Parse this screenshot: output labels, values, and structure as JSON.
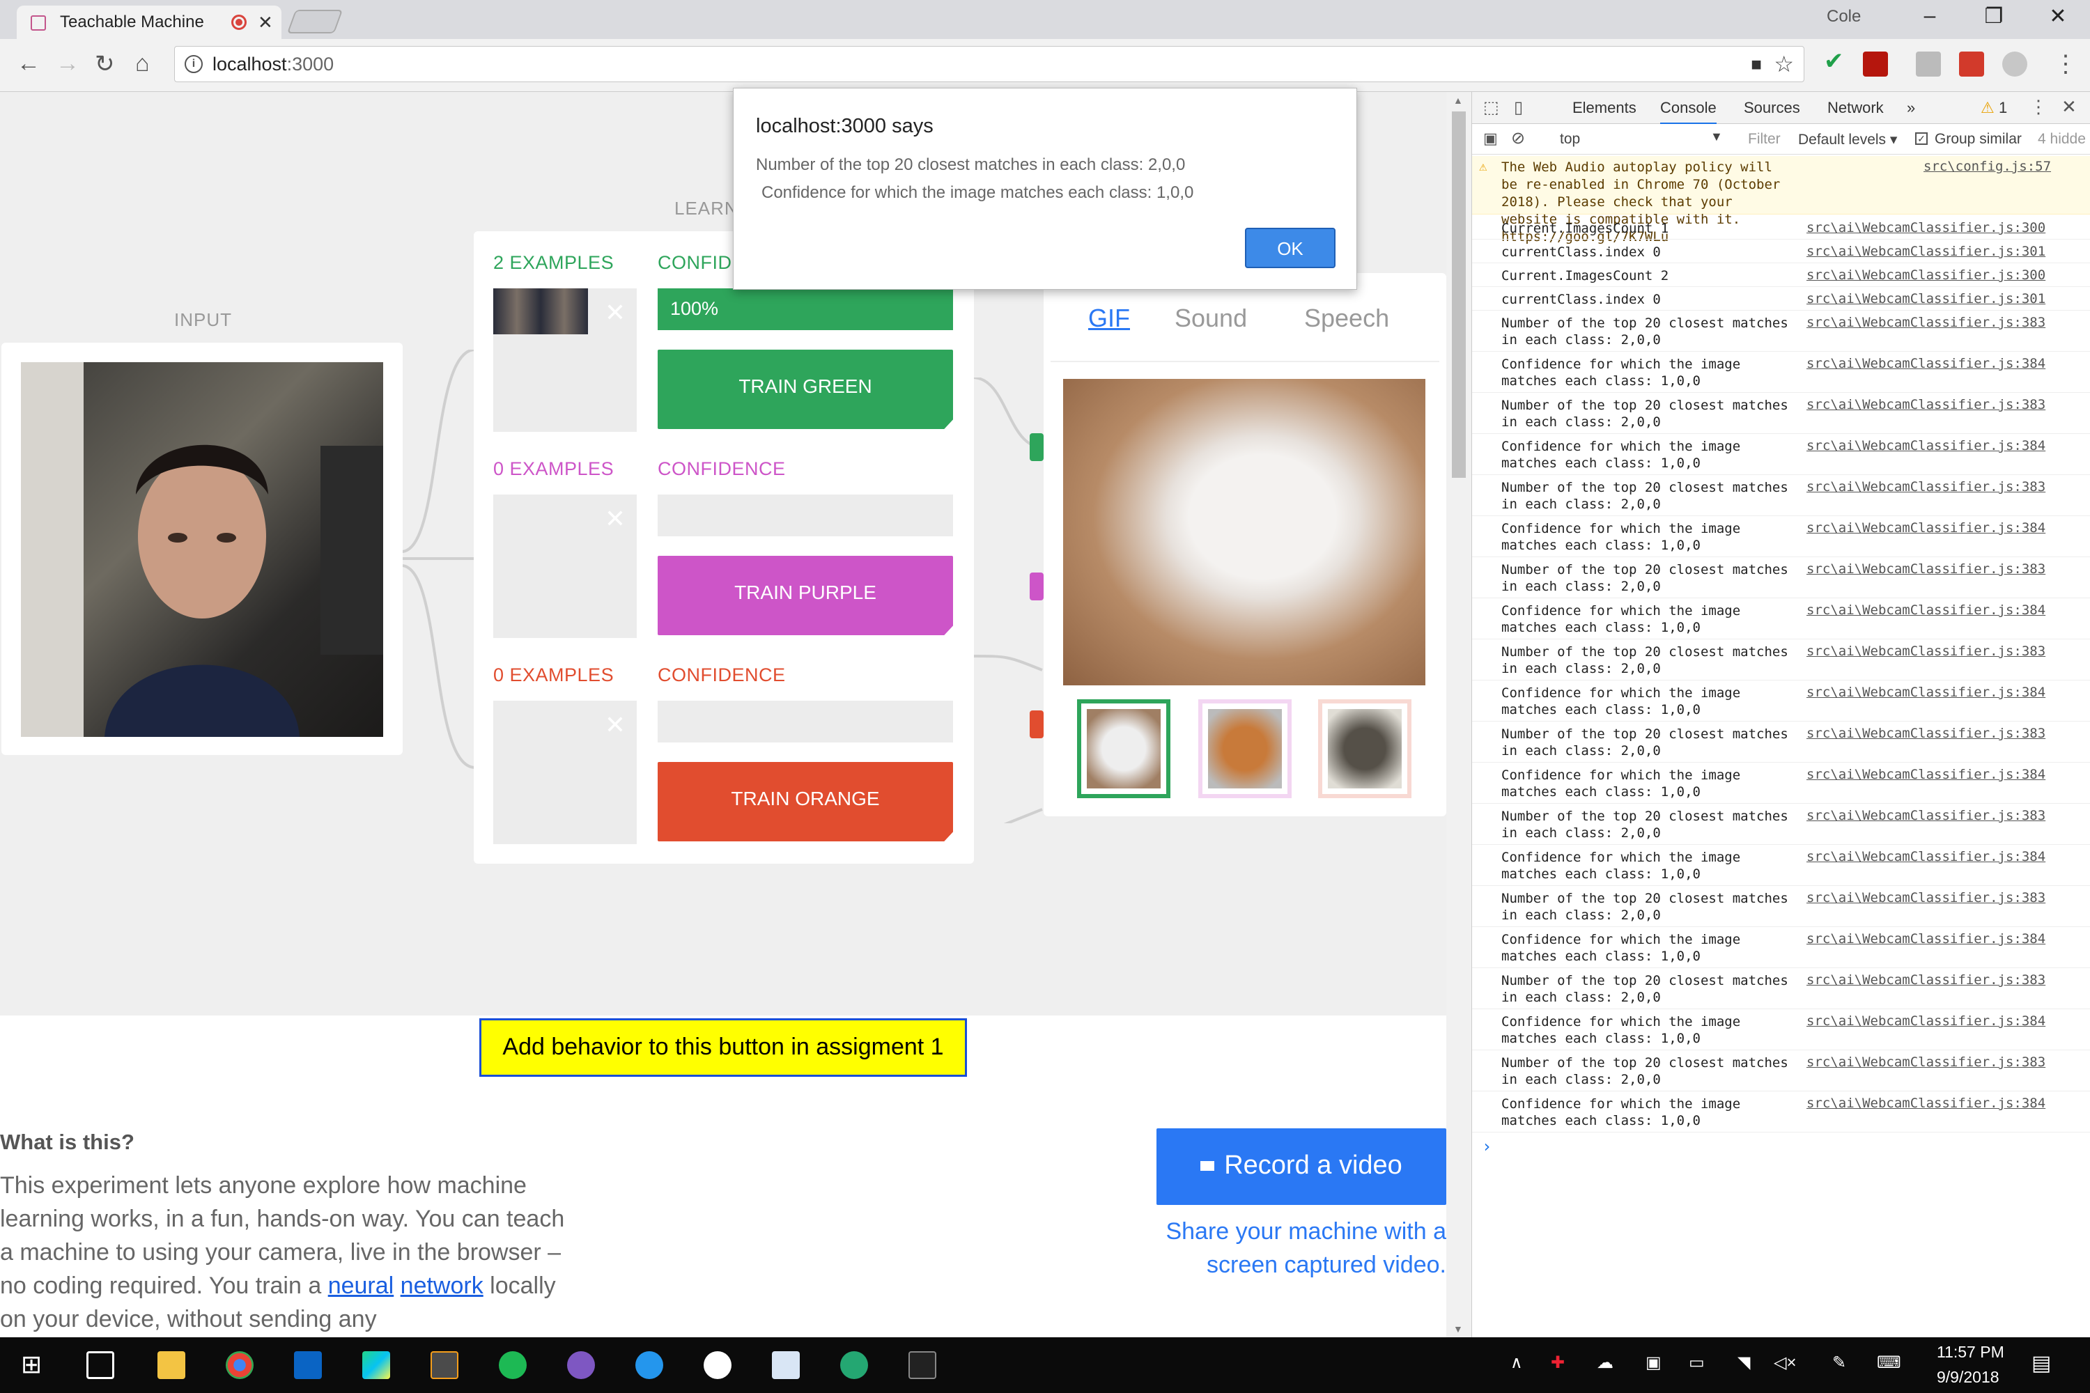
{
  "browser": {
    "tab_title": "Teachable Machine",
    "tab_close": "✕",
    "user": "Cole",
    "url_host": "localhost",
    "url_port": ":3000"
  },
  "page": {
    "input_label": "INPUT",
    "learning_label": "LEARNING",
    "classes": [
      {
        "examples": "2 EXAMPLES",
        "confidence_label": "CONFIDENCE",
        "confidence_value": "100%",
        "confidence": 1.0,
        "button": "TRAIN GREEN",
        "color": "#2ea55b"
      },
      {
        "examples": "0 EXAMPLES",
        "confidence_label": "CONFIDENCE",
        "confidence_value": "",
        "confidence": 0.0,
        "button": "TRAIN PURPLE",
        "color": "#cd55c8"
      },
      {
        "examples": "0 EXAMPLES",
        "confidence_label": "CONFIDENCE",
        "confidence_value": "",
        "confidence": 0.0,
        "button": "TRAIN ORANGE",
        "color": "#e14d2f"
      }
    ],
    "output_tabs": [
      "GIF",
      "Sound",
      "Speech"
    ],
    "assignment_button": "Add behavior to this button in assigment 1",
    "what_is_title": "What is this?",
    "desc_before": "This experiment lets anyone explore how machine learning works, in a fun, hands-on way. You can teach a machine to using your camera, live in the browser – no coding required. You train a ",
    "desc_link1": "neural",
    "desc_space": " ",
    "desc_link2": "network",
    "desc_after": " locally on your device, without sending any",
    "record_button": "Record a video",
    "share_text": "Share your machine with a screen captured video."
  },
  "alert": {
    "title": "localhost:3000 says",
    "line1": "Number of the top 20 closest matches in each class: 2,0,0",
    "line2": "Confidence for which the image matches each class: 1,0,0",
    "ok": "OK"
  },
  "devtools": {
    "tabs": [
      "Elements",
      "Console",
      "Sources",
      "Network",
      "»"
    ],
    "warning_count": "1",
    "context": "top",
    "filter_placeholder": "Filter",
    "levels": "Default levels ▾",
    "group_similar": "Group similar",
    "hidden": "4 hidde",
    "warning_msg": "The Web Audio autoplay policy will be re-enabled in Chrome 70 (October 2018). Please check that your website is compatible with it. https://goo.gl/7K7WLu",
    "warning_src": "src\\config.js:57",
    "logs": [
      {
        "msg": "Current.ImagesCount 1",
        "src": "src\\ai\\WebcamClassifier.js:300"
      },
      {
        "msg": "currentClass.index 0",
        "src": "src\\ai\\WebcamClassifier.js:301"
      },
      {
        "msg": "Current.ImagesCount 2",
        "src": "src\\ai\\WebcamClassifier.js:300"
      },
      {
        "msg": "currentClass.index 0",
        "src": "src\\ai\\WebcamClassifier.js:301"
      },
      {
        "msg": "Number of the top 20 closest matches\nin each class: 2,0,0",
        "src": "src\\ai\\WebcamClassifier.js:383"
      },
      {
        "msg": "Confidence for which the image\nmatches each class: 1,0,0",
        "src": "src\\ai\\WebcamClassifier.js:384"
      },
      {
        "msg": "Number of the top 20 closest matches\nin each class: 2,0,0",
        "src": "src\\ai\\WebcamClassifier.js:383"
      },
      {
        "msg": "Confidence for which the image\nmatches each class: 1,0,0",
        "src": "src\\ai\\WebcamClassifier.js:384"
      },
      {
        "msg": "Number of the top 20 closest matches\nin each class: 2,0,0",
        "src": "src\\ai\\WebcamClassifier.js:383"
      },
      {
        "msg": "Confidence for which the image\nmatches each class: 1,0,0",
        "src": "src\\ai\\WebcamClassifier.js:384"
      },
      {
        "msg": "Number of the top 20 closest matches\nin each class: 2,0,0",
        "src": "src\\ai\\WebcamClassifier.js:383"
      },
      {
        "msg": "Confidence for which the image\nmatches each class: 1,0,0",
        "src": "src\\ai\\WebcamClassifier.js:384"
      },
      {
        "msg": "Number of the top 20 closest matches\nin each class: 2,0,0",
        "src": "src\\ai\\WebcamClassifier.js:383"
      },
      {
        "msg": "Confidence for which the image\nmatches each class: 1,0,0",
        "src": "src\\ai\\WebcamClassifier.js:384"
      },
      {
        "msg": "Number of the top 20 closest matches\nin each class: 2,0,0",
        "src": "src\\ai\\WebcamClassifier.js:383"
      },
      {
        "msg": "Confidence for which the image\nmatches each class: 1,0,0",
        "src": "src\\ai\\WebcamClassifier.js:384"
      },
      {
        "msg": "Number of the top 20 closest matches\nin each class: 2,0,0",
        "src": "src\\ai\\WebcamClassifier.js:383"
      },
      {
        "msg": "Confidence for which the image\nmatches each class: 1,0,0",
        "src": "src\\ai\\WebcamClassifier.js:384"
      },
      {
        "msg": "Number of the top 20 closest matches\nin each class: 2,0,0",
        "src": "src\\ai\\WebcamClassifier.js:383"
      },
      {
        "msg": "Confidence for which the image\nmatches each class: 1,0,0",
        "src": "src\\ai\\WebcamClassifier.js:384"
      },
      {
        "msg": "Number of the top 20 closest matches\nin each class: 2,0,0",
        "src": "src\\ai\\WebcamClassifier.js:383"
      },
      {
        "msg": "Confidence for which the image\nmatches each class: 1,0,0",
        "src": "src\\ai\\WebcamClassifier.js:384"
      },
      {
        "msg": "Number of the top 20 closest matches\nin each class: 2,0,0",
        "src": "src\\ai\\WebcamClassifier.js:383"
      },
      {
        "msg": "Confidence for which the image\nmatches each class: 1,0,0",
        "src": "src\\ai\\WebcamClassifier.js:384"
      }
    ],
    "prompt": "›"
  },
  "taskbar": {
    "time": "11:57 PM",
    "date": "9/9/2018"
  }
}
